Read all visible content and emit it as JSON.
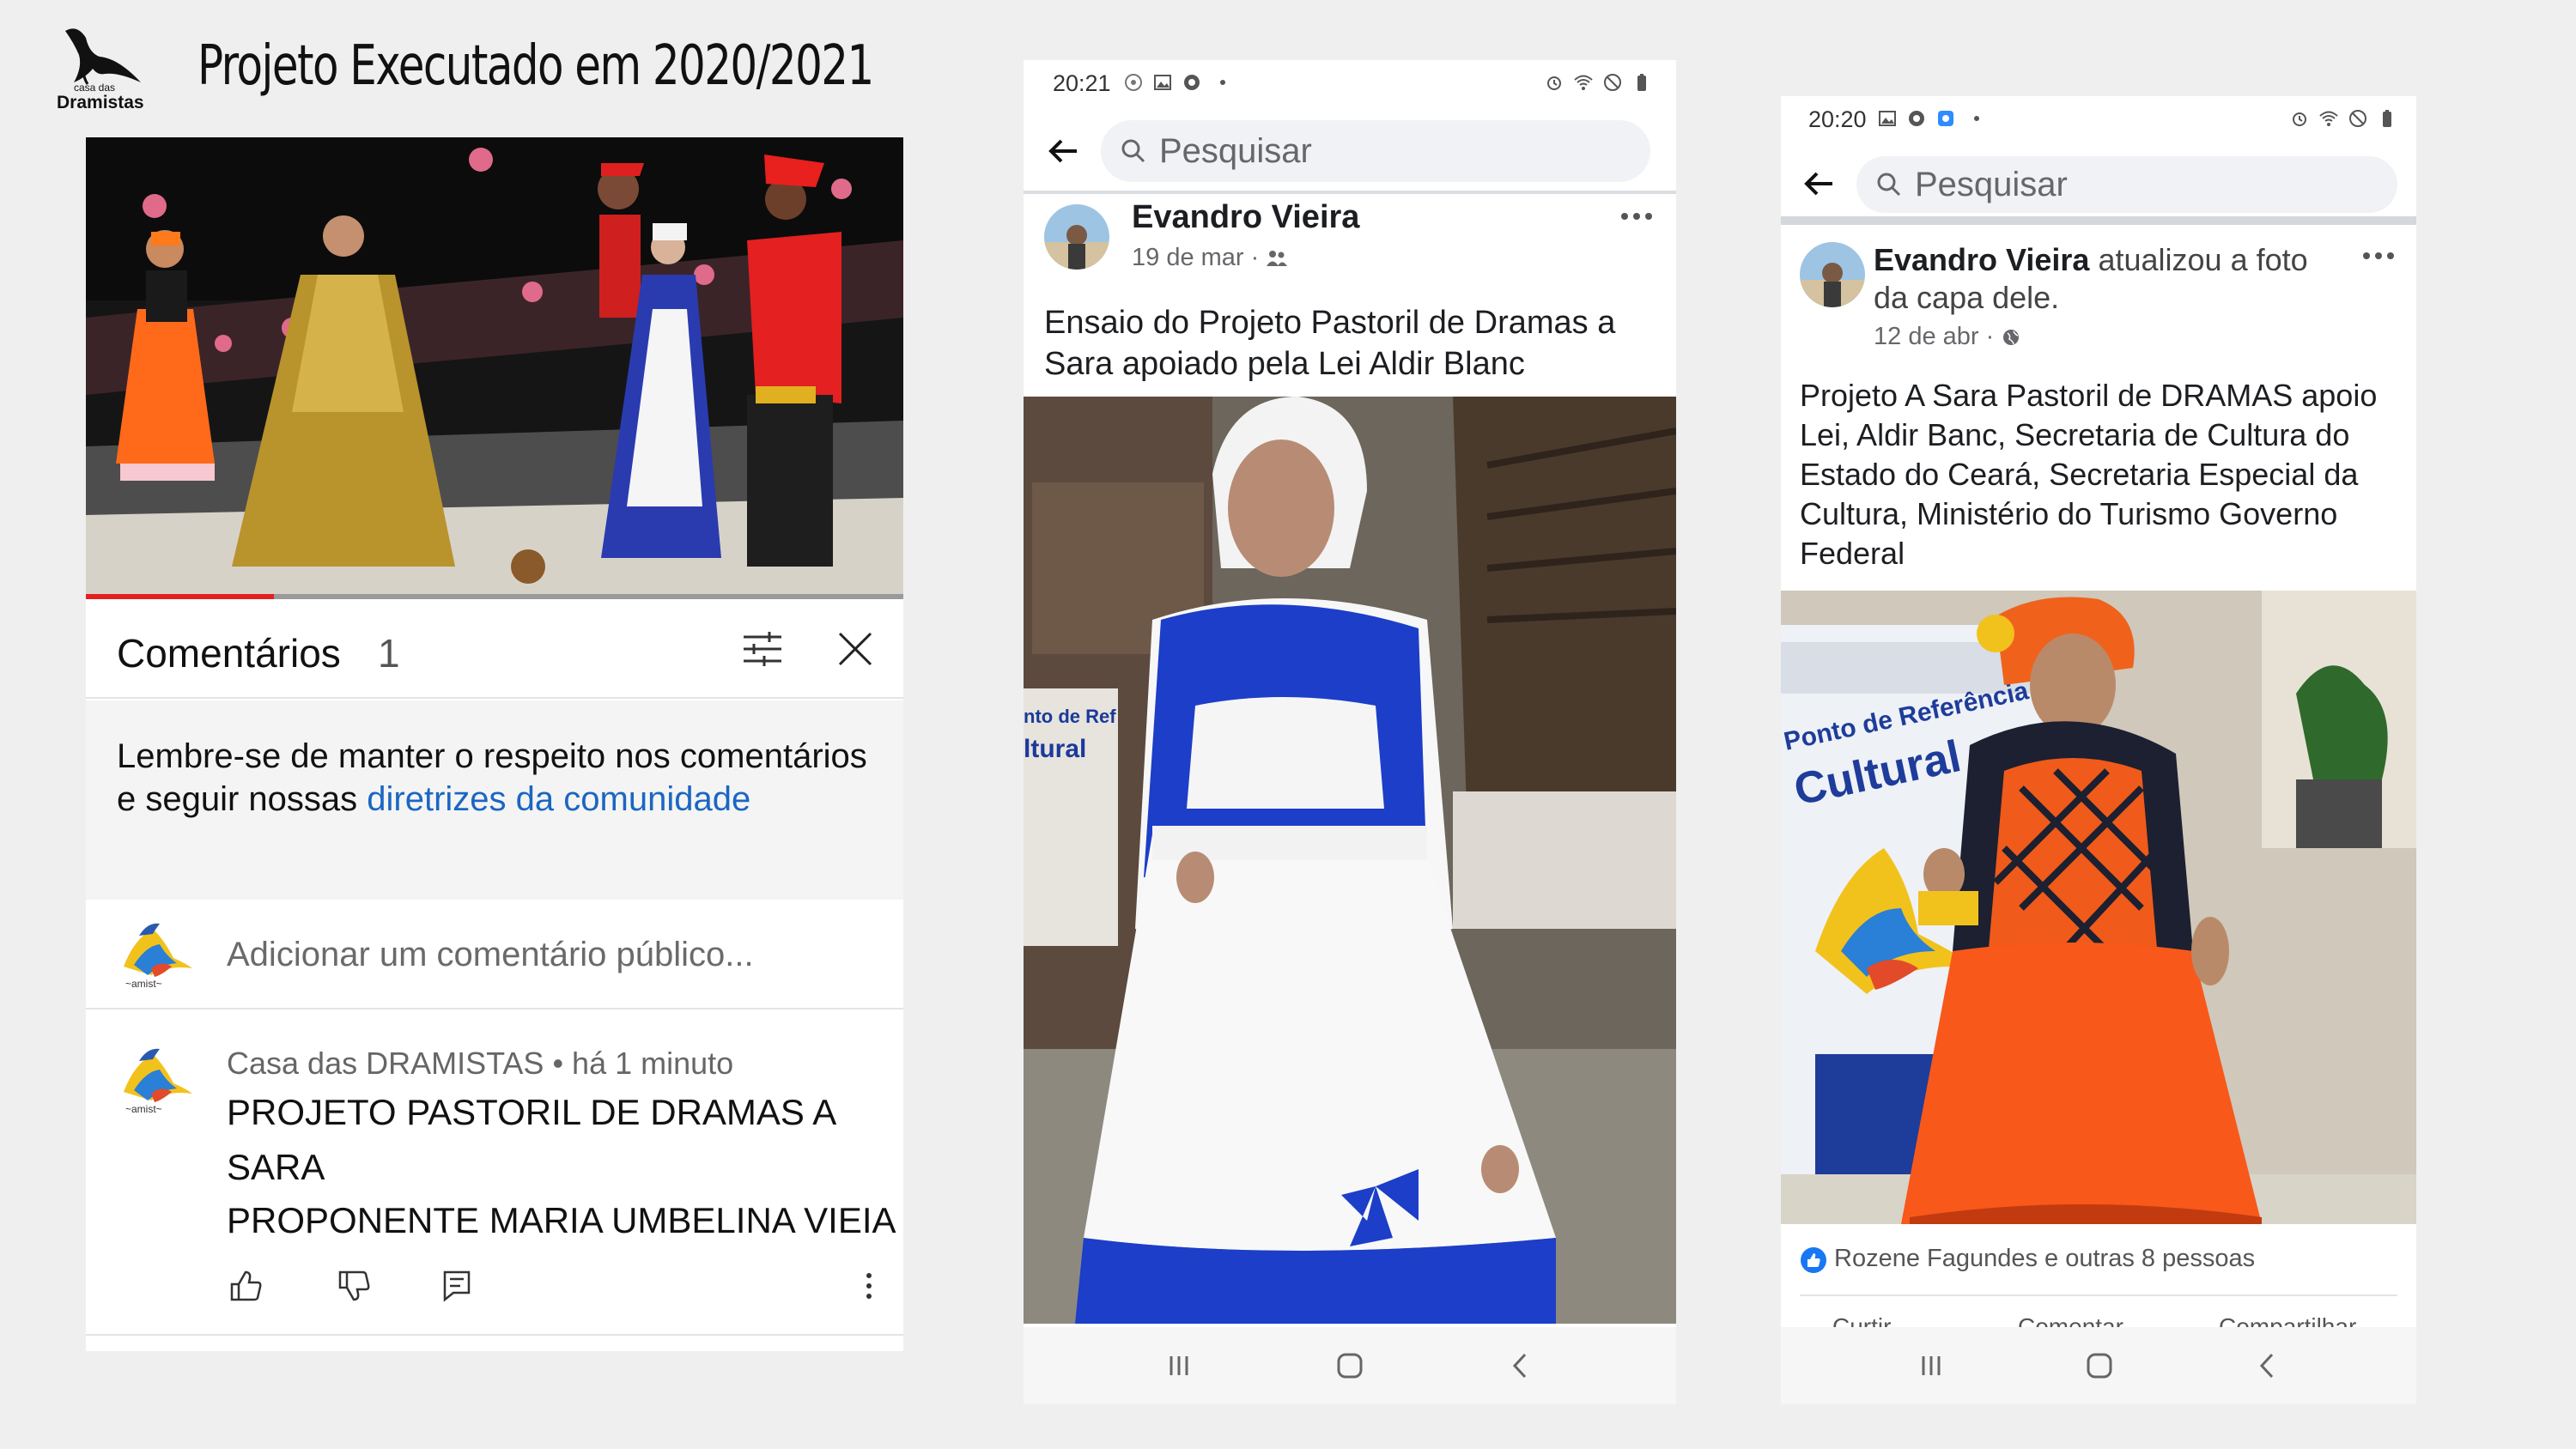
{
  "slide": {
    "title": "Projeto Executado em 2020/2021",
    "logo_icon": "casa-das-dramistas-logo"
  },
  "youtube": {
    "progress": 0.23,
    "comments_title": "Comentários",
    "comments_count": "1",
    "notice_text": "Lembre-se de manter o respeito nos comentários e seguir nossas ",
    "notice_link": "diretrizes da comunidade",
    "add_comment_placeholder": "Adicionar um comentário público...",
    "comment": {
      "author": "Casa das DRAMISTAS • há 1 minuto",
      "line1": "PROJETO PASTORIL DE DRAMAS A",
      "line2": "SARA",
      "line3": "PROPONENTE MARIA UMBELINA VIEIA"
    }
  },
  "post1": {
    "status_time": "20:21",
    "search_placeholder": "Pesquisar",
    "author": "Evandro Vieira",
    "date": "19 de mar ·",
    "text_line1": "Ensaio do Projeto Pastoril de Dramas a",
    "text_line2": "Sara apoiado pela Lei Aldir Blanc"
  },
  "post2": {
    "status_time": "20:20",
    "search_placeholder": "Pesquisar",
    "author": "Evandro Vieira",
    "author_action_1": " atualizou a foto",
    "author_action_2": "da capa dele.",
    "date": "12 de abr ·",
    "text_lines": [
      "Projeto A Sara Pastoril de DRAMAS apoio",
      "Lei, Aldir Banc, Secretaria de Cultura do",
      "Estado do Ceará, Secretaria Especial da",
      "Cultura, Ministério do Turismo Governo",
      "Federal"
    ],
    "likes_text": "Rozene Fagundes e outras 8 pessoas",
    "actions": [
      "Curtir",
      "Comentar",
      "Compartilhar"
    ]
  }
}
